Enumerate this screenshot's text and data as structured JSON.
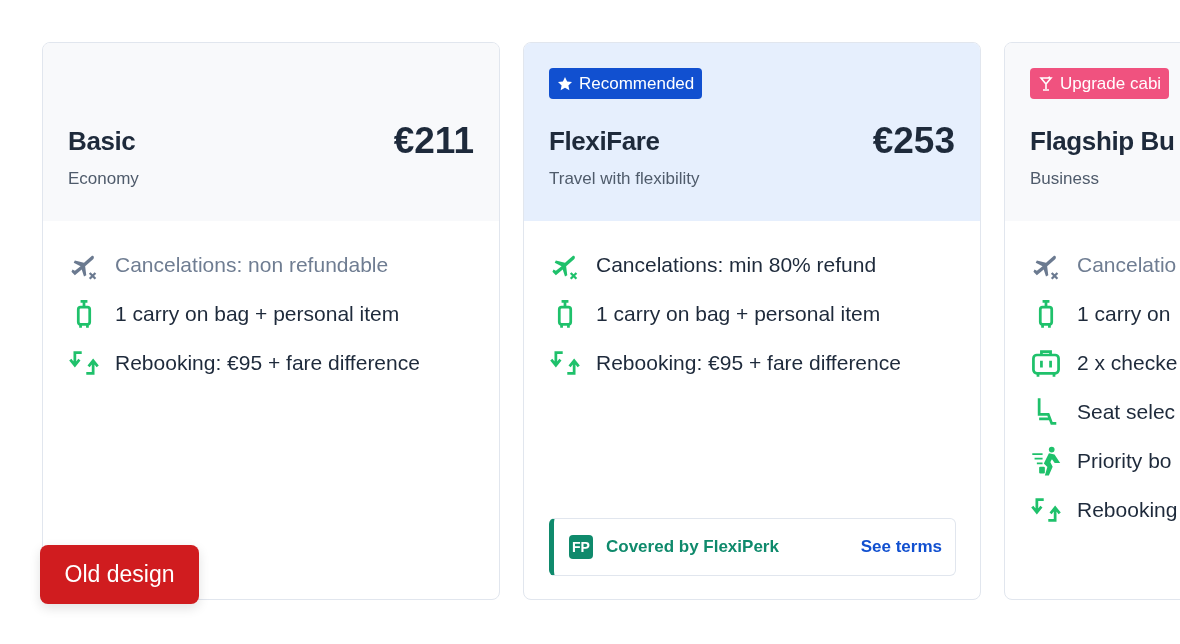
{
  "cards": [
    {
      "title": "Basic",
      "subtitle": "Economy",
      "price": "€211",
      "selected": false,
      "features": [
        {
          "kind": "cancel",
          "text": "Cancelations: non refundable",
          "included": false
        },
        {
          "kind": "carry-on",
          "text": "1 carry on bag + personal item",
          "included": true
        },
        {
          "kind": "rebook",
          "text": "Rebooking:  €95 + fare difference",
          "included": true
        }
      ]
    },
    {
      "title": "FlexiFare",
      "subtitle": "Travel with flexibility",
      "price": "€253",
      "selected": true,
      "badge": {
        "kind": "recommended",
        "text": "Recommended"
      },
      "features": [
        {
          "kind": "cancel",
          "text": "Cancelations: min 80% refund",
          "included": true
        },
        {
          "kind": "carry-on",
          "text": "1 carry on bag + personal item",
          "included": true
        },
        {
          "kind": "rebook",
          "text": "Rebooking:  €95 + fare difference",
          "included": true
        }
      ],
      "perk": {
        "logo": "FP",
        "text": "Covered by FlexiPerk",
        "link": "See terms"
      }
    },
    {
      "title": "Flagship Bu",
      "subtitle": "Business",
      "selected": false,
      "badge": {
        "kind": "upgrade",
        "text": "Upgrade cabi"
      },
      "features": [
        {
          "kind": "cancel",
          "text": "Cancelatio",
          "included": false
        },
        {
          "kind": "carry-on",
          "text": "1 carry on",
          "included": true
        },
        {
          "kind": "checked",
          "text": "2 x checke",
          "included": true
        },
        {
          "kind": "seat",
          "text": "Seat selec",
          "included": true
        },
        {
          "kind": "priority",
          "text": "Priority bo",
          "included": true
        },
        {
          "kind": "rebook",
          "text": "Rebooking",
          "included": true
        }
      ]
    }
  ],
  "old_design_button": "Old design"
}
